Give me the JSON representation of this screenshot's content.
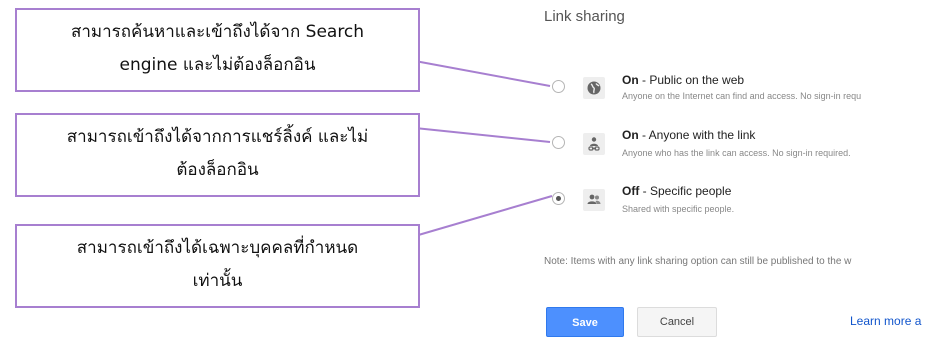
{
  "dialog": {
    "title": "Link sharing",
    "options": [
      {
        "title_strong": "On",
        "title_rest": " - Public on the web",
        "description": "Anyone on the Internet can find and access. No sign-in requ",
        "icon": "globe-icon",
        "selected": false
      },
      {
        "title_strong": "On",
        "title_rest": " - Anyone with the link",
        "description": "Anyone who has the link can access. No sign-in required.",
        "icon": "link-person-icon",
        "selected": false
      },
      {
        "title_strong": "Off",
        "title_rest": " - Specific people",
        "description": "Shared with specific people.",
        "icon": "people-icon",
        "selected": true
      }
    ],
    "note": "Note: Items with any link sharing option can still be published to the w",
    "save_label": "Save",
    "cancel_label": "Cancel",
    "learn_more_label": "Learn more a"
  },
  "annotations": [
    {
      "line1": "สามารถค้นหาและเข้าถึงได้จาก Search",
      "line2": "engine และไม่ต้องล็อกอิน"
    },
    {
      "line1": "สามารถเข้าถึงได้จากการแชร์ลิ้งค์ และไม่",
      "line2": "ต้องล็อกอิน"
    },
    {
      "line1": "สามารถเข้าถึงได้เฉพาะบุคคลที่กำหนด",
      "line2": "เท่านั้น"
    }
  ],
  "colors": {
    "callout_border": "#a77fd0",
    "save_button": "#4d90fe",
    "link": "#1155cc"
  }
}
